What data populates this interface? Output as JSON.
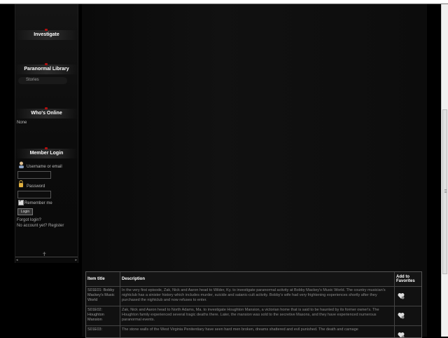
{
  "sidebar": {
    "investigate": "Investigate",
    "library": "Paranormal Library",
    "library_items": [
      "Stories"
    ],
    "whos_online": "Who's Online",
    "online_text": "None",
    "member_login": "Member Login",
    "username_label": "Username or email",
    "password_label": "Password",
    "remember_label": "Remember me",
    "login_button": "Login",
    "forgot_link": "Forgot login?",
    "register_link": "No account yet? Register"
  },
  "table": {
    "headers": [
      "Item title",
      "Description",
      "Add to Favorites"
    ],
    "rows": [
      {
        "title": "S01E01: Bobby Mackey's Music World",
        "description": "In the very first episode, Zak, Nick and Aaron head to Wilder, Ky. to investigate paranormal activity at Bobby Mackey's Music World. The country musician's nightclub has a sinister history which includes murder, suicide and satanic-cult activity. Bobby's wife had very frightening experiences shortly after they purchased the nightclub and now refuses to enter."
      },
      {
        "title": "S01E02: Houghton Mansion",
        "description": "Zak, Nick and Aaron head to North Adams, Ma. to investigate Houghton Mansion, a victorian home that is said to be haunted by its former owner's. The Houghton family experienced several tragic deaths there. Later, the mansion was sold to the secretive Masons, and they have experienced numerous paranormal events."
      },
      {
        "title": "S01E03:",
        "description": "The stone walls of the West Virginia Penitentiary have seen hard men broken, dreams shattered and evil punished. The death and carnage"
      }
    ]
  }
}
